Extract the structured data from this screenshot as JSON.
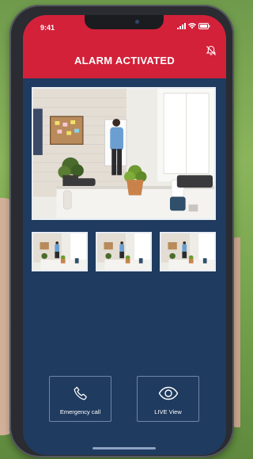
{
  "status_bar": {
    "time": "9:41"
  },
  "header": {
    "title": "ALARM ACTIVATED",
    "mute_icon": "bell-off-icon"
  },
  "camera": {
    "main_feed": {
      "description_icon": "camera-feed-image"
    },
    "thumbnails": [
      {
        "name": "thumbnail-1"
      },
      {
        "name": "thumbnail-2"
      },
      {
        "name": "thumbnail-3"
      }
    ]
  },
  "actions": {
    "emergency": {
      "label": "Emergency call",
      "icon": "phone-icon"
    },
    "live": {
      "label": "LIVE View",
      "icon": "eye-icon"
    }
  },
  "colors": {
    "header_red": "#d3213a",
    "screen_navy": "#1f3b5f",
    "button_border": "#6f86a6"
  }
}
